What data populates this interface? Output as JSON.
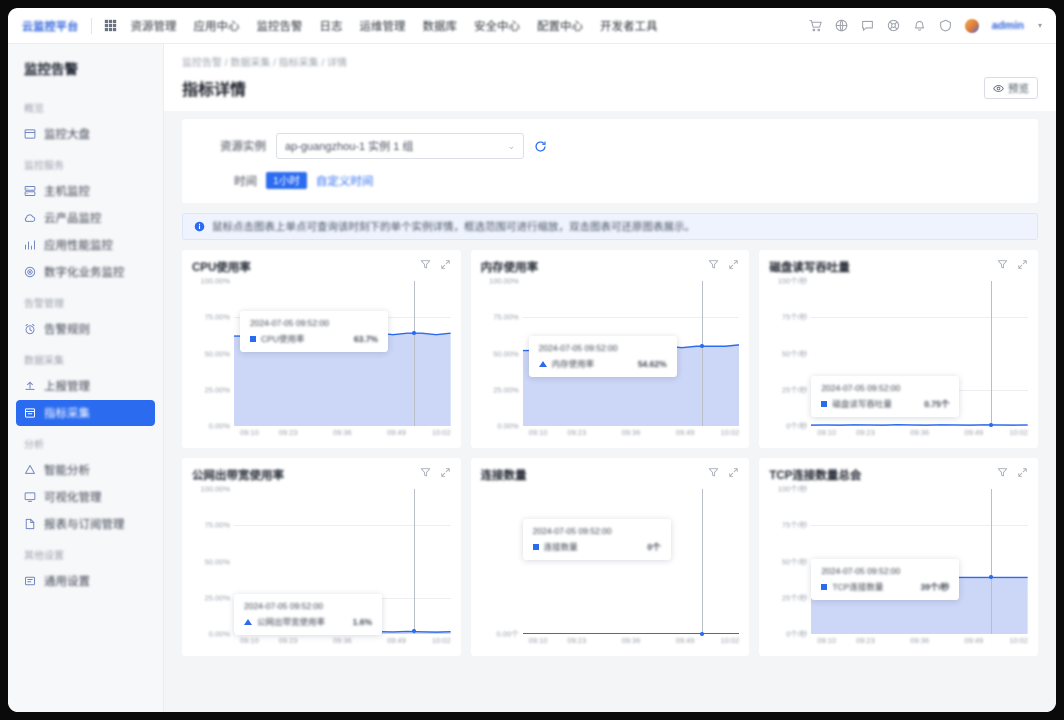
{
  "topnav": {
    "brand": "云监控平台",
    "grid_icon": "grid-icon",
    "items": [
      {
        "label": "资源管理"
      },
      {
        "label": "应用中心"
      },
      {
        "label": "监控告警"
      },
      {
        "label": "日志"
      },
      {
        "label": "运维管理"
      },
      {
        "label": "数据库"
      },
      {
        "label": "安全中心"
      },
      {
        "label": "配置中心"
      },
      {
        "label": "开发者工具"
      }
    ],
    "right_icons": [
      "shopping-cart-icon",
      "globe-icon",
      "message-icon",
      "support-icon",
      "bell-icon",
      "help-icon"
    ],
    "avatar": "user-avatar",
    "username": "admin",
    "caret": "▾"
  },
  "sidebar": {
    "title": "监控告警",
    "groups": [
      {
        "label": "概览",
        "items": [
          {
            "label": "监控大盘",
            "icon": "dashboard-icon",
            "active": false
          }
        ]
      },
      {
        "label": "监控服务",
        "items": [
          {
            "label": "主机监控",
            "icon": "server-icon",
            "active": false
          },
          {
            "label": "云产品监控",
            "icon": "cloud-icon",
            "active": false
          },
          {
            "label": "应用性能监控",
            "icon": "chart-icon",
            "active": false
          },
          {
            "label": "数字化业务监控",
            "icon": "target-icon",
            "active": false
          }
        ]
      },
      {
        "label": "告警管理",
        "items": [
          {
            "label": "告警规则",
            "icon": "alarm-icon",
            "active": false
          }
        ]
      },
      {
        "label": "数据采集",
        "items": [
          {
            "label": "上报管理",
            "icon": "upload-icon",
            "active": false
          },
          {
            "label": "指标采集",
            "icon": "collect-icon",
            "active": true
          }
        ]
      },
      {
        "label": "分析",
        "items": [
          {
            "label": "智能分析",
            "icon": "analysis-icon",
            "active": false
          },
          {
            "label": "可视化管理",
            "icon": "screen-icon",
            "active": false
          },
          {
            "label": "报表与订阅管理",
            "icon": "report-icon",
            "active": false
          }
        ]
      },
      {
        "label": "其他设置",
        "items": [
          {
            "label": "通用设置",
            "icon": "settings-icon",
            "active": false
          }
        ]
      }
    ]
  },
  "page": {
    "breadcrumb": "监控告警 / 数据采集 / 指标采集 / 详情",
    "title": "指标详情",
    "preview_button": {
      "label": "预览",
      "icon": "eye-icon"
    }
  },
  "filter": {
    "field_label": "资源实例",
    "select_value": "ap-guangzhou-1 实例 1 组",
    "select_chevron": "⌄",
    "refresh_icon": "refresh-icon",
    "range_label": "时间",
    "range_tag": "1小时",
    "range_link": "自定义时间"
  },
  "alert": {
    "icon": "info-icon",
    "text": "鼠标点击图表上单点可查询该时刻下的单个实例详情，框选范围可进行缩放，双击图表可还原图表展示。"
  },
  "chart_data": [
    {
      "type": "area",
      "title": "CPU使用率",
      "actions": [
        "filter-icon",
        "expand-icon"
      ],
      "ylabel": "",
      "ytick_labels": [
        "100.00%",
        "75.00%",
        "50.00%",
        "25.00%",
        "0.00%"
      ],
      "ylim": [
        0,
        100
      ],
      "x": [
        "09:10",
        "09:23",
        "09:36",
        "09:49",
        "10:02"
      ],
      "values": [
        62,
        62,
        63,
        62,
        63,
        63,
        64,
        63,
        63,
        64,
        64,
        63,
        64,
        64,
        63,
        64
      ],
      "tooltip": {
        "time": "2024-07-05 09:52:00",
        "series": "CPU使用率",
        "value": "63.7%",
        "marker": "square"
      }
    },
    {
      "type": "area",
      "title": "内存使用率",
      "actions": [
        "filter-icon",
        "expand-icon"
      ],
      "ylabel": "",
      "ytick_labels": [
        "100.00%",
        "75.00%",
        "50.00%",
        "25.00%",
        "0.00%"
      ],
      "ylim": [
        0,
        100
      ],
      "x": [
        "09:10",
        "09:23",
        "09:36",
        "09:49",
        "10:02"
      ],
      "values": [
        52,
        52,
        53,
        54,
        54,
        53,
        54,
        55,
        54,
        55,
        55,
        54,
        55,
        55,
        55,
        56
      ],
      "tooltip": {
        "time": "2024-07-05 09:52:00",
        "series": "内存使用率",
        "value": "54.62%",
        "marker": "triangle"
      }
    },
    {
      "type": "area",
      "title": "磁盘读写吞吐量",
      "actions": [
        "filter-icon",
        "expand-icon"
      ],
      "ylabel": "",
      "ytick_labels": [
        "100个/秒",
        "75个/秒",
        "50个/秒",
        "25个/秒",
        "0个/秒"
      ],
      "ylim": [
        0,
        100
      ],
      "x": [
        "09:10",
        "09:23",
        "09:36",
        "09:49",
        "10:02"
      ],
      "values": [
        0.6,
        0.7,
        0.6,
        0.8,
        0.7,
        0.6,
        0.9,
        0.7,
        0.6,
        0.8,
        0.7,
        0.6,
        0.8,
        0.7,
        0.6,
        0.7
      ],
      "tooltip": {
        "time": "2024-07-05 09:52:00",
        "series": "磁盘读写吞吐量",
        "value": "0.75个",
        "marker": "square"
      }
    },
    {
      "type": "area",
      "title": "公网出带宽使用率",
      "actions": [
        "filter-icon",
        "expand-icon"
      ],
      "ylabel": "",
      "ytick_labels": [
        "100.00%",
        "75.00%",
        "50.00%",
        "25.00%",
        "0.00%"
      ],
      "ylim": [
        0,
        100
      ],
      "x": [
        "09:10",
        "09:23",
        "09:36",
        "09:49",
        "10:02"
      ],
      "values": [
        1.4,
        1.6,
        1.3,
        1.8,
        1.5,
        1.4,
        2.0,
        1.7,
        1.4,
        1.9,
        1.6,
        1.4,
        1.8,
        1.5,
        1.3,
        1.6
      ],
      "tooltip": {
        "time": "2024-07-05 09:52:00",
        "series": "公网出带宽使用率",
        "value": "1.6%",
        "marker": "triangle"
      }
    },
    {
      "type": "line",
      "title": "连接数量",
      "actions": [
        "filter-icon",
        "expand-icon"
      ],
      "ylabel": "",
      "ytick_labels": [
        "0.00个"
      ],
      "ylim": [
        0,
        100
      ],
      "x": [
        "09:10",
        "09:23",
        "09:36",
        "09:49",
        "10:02"
      ],
      "values": [
        0,
        0,
        0,
        0,
        0,
        0,
        0,
        0,
        0,
        0,
        0,
        0,
        0,
        0,
        0,
        0
      ],
      "tooltip": {
        "time": "2024-07-05 09:52:00",
        "series": "连接数量",
        "value": "0个",
        "marker": "square"
      }
    },
    {
      "type": "area",
      "title": "TCP连接数量总会",
      "actions": [
        "filter-icon",
        "expand-icon"
      ],
      "ylabel": "",
      "ytick_labels": [
        "100个/秒",
        "75个/秒",
        "50个/秒",
        "25个/秒",
        "0个/秒"
      ],
      "ylim": [
        0,
        100
      ],
      "x": [
        "09:10",
        "09:23",
        "09:36",
        "09:49",
        "10:02"
      ],
      "values": [
        39,
        39,
        39,
        39,
        39,
        39,
        39,
        39,
        39,
        39,
        39,
        39,
        39,
        39,
        39,
        39
      ],
      "tooltip": {
        "time": "2024-07-05 09:52:00",
        "series": "TCP连接数量",
        "value": "39个/秒",
        "marker": "square"
      }
    }
  ]
}
